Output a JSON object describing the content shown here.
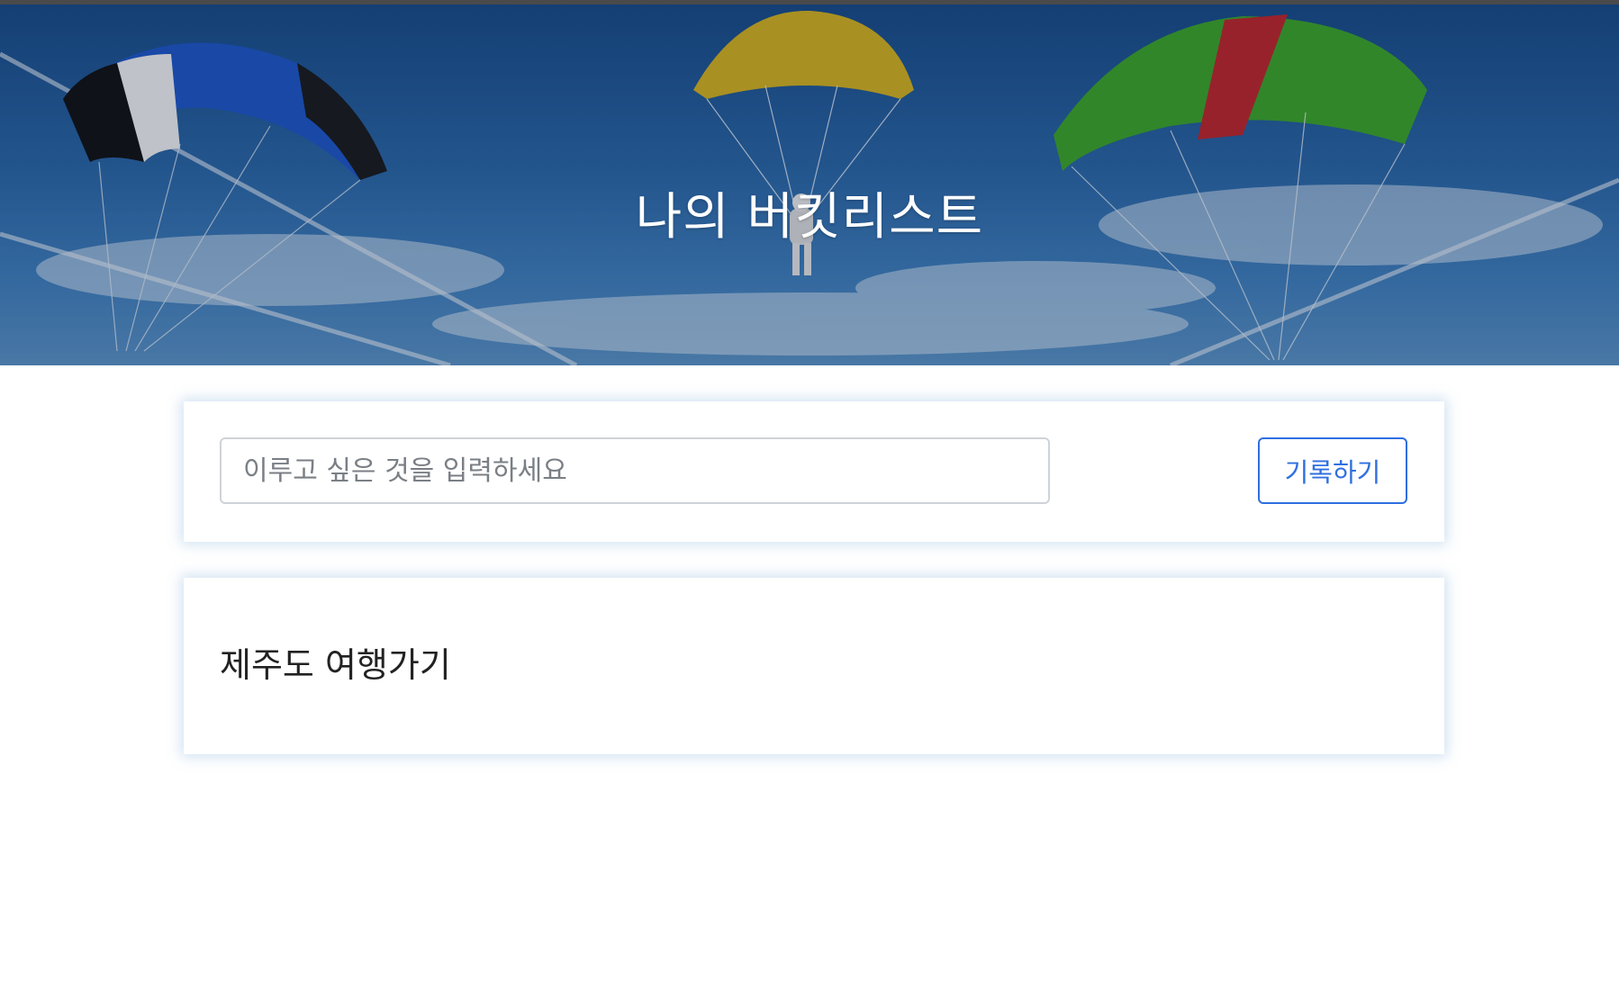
{
  "header": {
    "title": "나의 버킷리스트",
    "background": "skydiving-parachutes-sky-photo"
  },
  "form": {
    "input_placeholder": "이루고 싶은 것을 입력하세요",
    "input_value": "",
    "submit_label": "기록하기"
  },
  "bucket_list": {
    "items": [
      {
        "text": "제주도 여행가기"
      }
    ]
  },
  "colors": {
    "accent": "#2f6fe0",
    "card_shadow": "#78aad7",
    "title": "#ffffff"
  }
}
